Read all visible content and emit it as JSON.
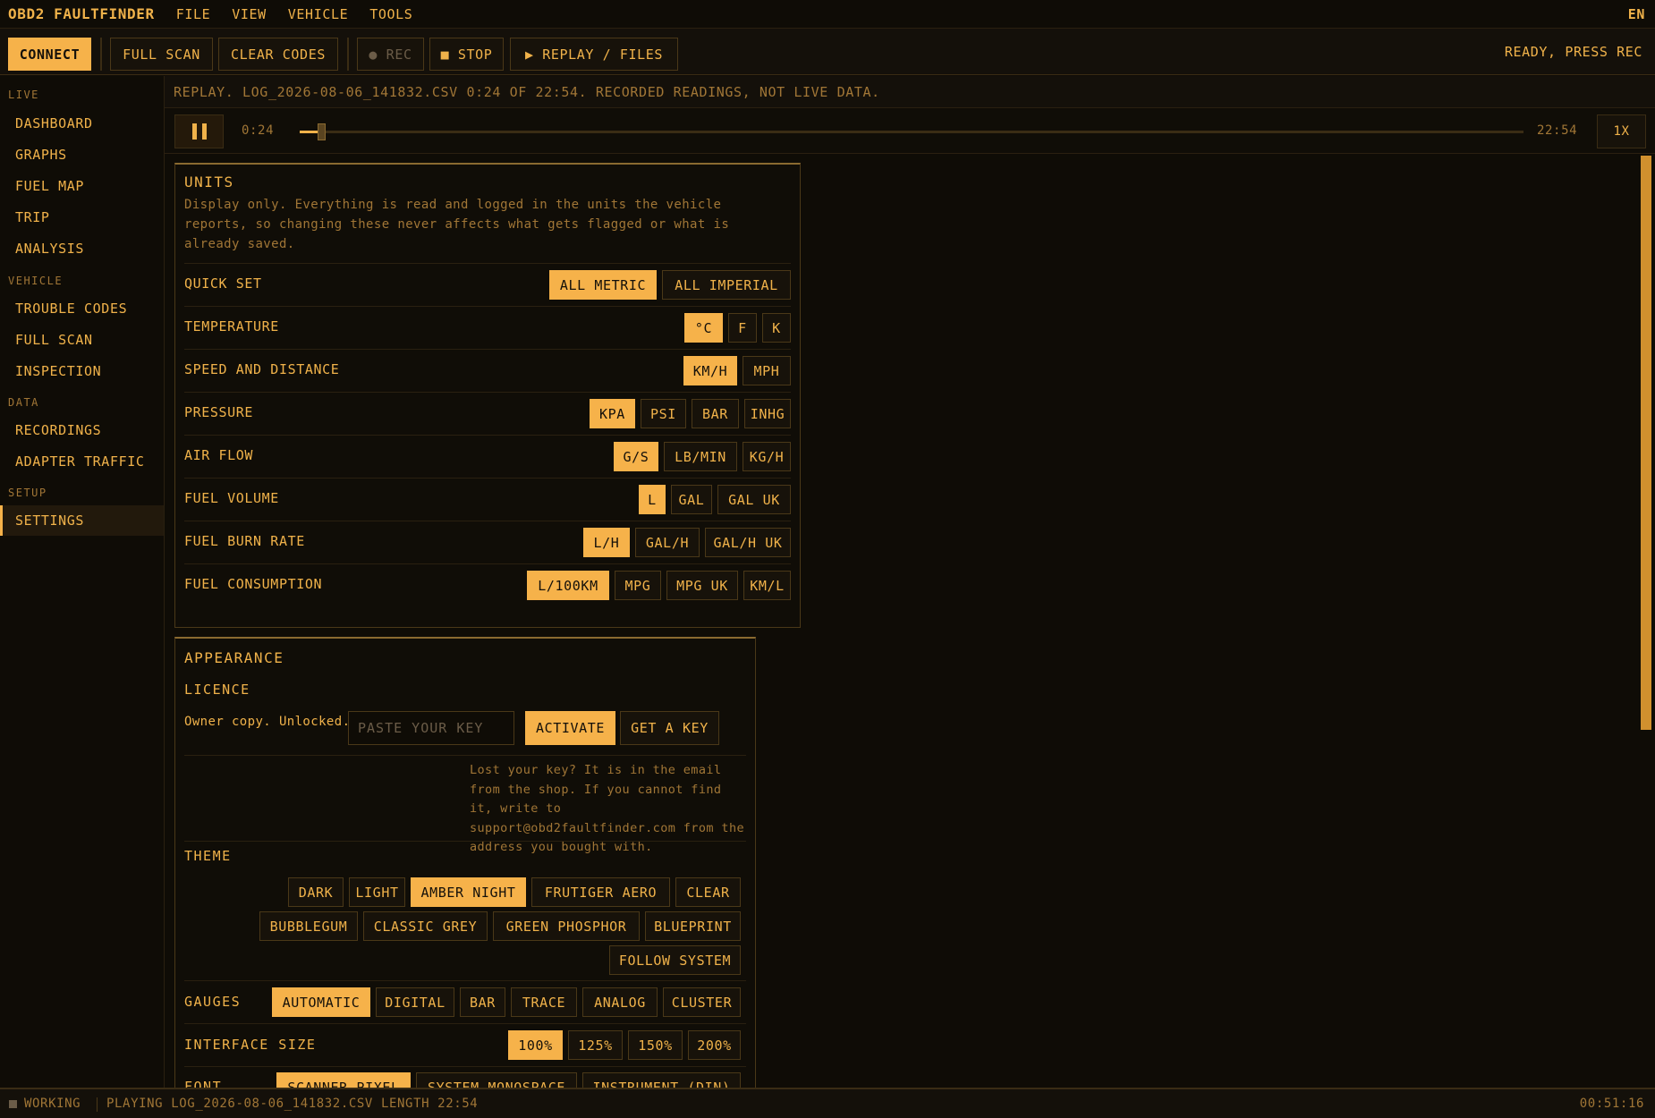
{
  "menubar": {
    "brand": "OBD2 FAULTFINDER",
    "menus": [
      "FILE",
      "VIEW",
      "VEHICLE",
      "TOOLS"
    ],
    "language": "EN"
  },
  "toolbar": {
    "connect": "CONNECT",
    "full_scan": "FULL SCAN",
    "clear_codes": "CLEAR CODES",
    "rec": "● REC",
    "stop": "■ STOP",
    "replay_files": "▶ REPLAY / FILES",
    "status": "READY, PRESS REC"
  },
  "sidebar": {
    "sections": [
      {
        "title": "LIVE",
        "items": [
          "DASHBOARD",
          "GRAPHS",
          "FUEL MAP",
          "TRIP",
          "ANALYSIS"
        ]
      },
      {
        "title": "VEHICLE",
        "items": [
          "TROUBLE CODES",
          "FULL SCAN",
          "INSPECTION"
        ]
      },
      {
        "title": "DATA",
        "items": [
          "RECORDINGS",
          "ADAPTER TRAFFIC"
        ]
      },
      {
        "title": "SETUP",
        "items": [
          "SETTINGS"
        ]
      }
    ],
    "active": "SETTINGS"
  },
  "replay": {
    "banner": "REPLAY. LOG_2026-08-06_141832.CSV 0:24 OF 22:54. RECORDED READINGS, NOT LIVE DATA.",
    "current": "0:24",
    "length": "22:54",
    "progress": 0.0175,
    "speed": "1X"
  },
  "units": {
    "title": "UNITS",
    "description": "Display only. Everything is read and logged in the units the vehicle reports, so changing these never affects what gets flagged or what is already saved.",
    "rows": [
      {
        "label": "QUICK SET",
        "options": [
          "ALL METRIC",
          "ALL IMPERIAL"
        ],
        "selected": 0
      },
      {
        "label": "TEMPERATURE",
        "options": [
          "°C",
          "F",
          "K"
        ],
        "selected": 0
      },
      {
        "label": "SPEED AND DISTANCE",
        "options": [
          "KM/H",
          "MPH"
        ],
        "selected": 0
      },
      {
        "label": "PRESSURE",
        "options": [
          "KPA",
          "PSI",
          "BAR",
          "INHG"
        ],
        "selected": 0
      },
      {
        "label": "AIR FLOW",
        "options": [
          "G/S",
          "LB/MIN",
          "KG/H"
        ],
        "selected": 0
      },
      {
        "label": "FUEL VOLUME",
        "options": [
          "L",
          "GAL",
          "GAL UK"
        ],
        "selected": 0
      },
      {
        "label": "FUEL BURN RATE",
        "options": [
          "L/H",
          "GAL/H",
          "GAL/H UK"
        ],
        "selected": 0
      },
      {
        "label": "FUEL CONSUMPTION",
        "options": [
          "L/100KM",
          "MPG",
          "MPG UK",
          "KM/L"
        ],
        "selected": 0
      }
    ]
  },
  "appearance": {
    "title": "APPEARANCE",
    "licence": {
      "title": "LICENCE",
      "status": "Owner copy. Unlocked.",
      "placeholder": "PASTE YOUR KEY",
      "activate": "ACTIVATE",
      "get_key": "GET A KEY",
      "help": "Lost your key? It is in the email from the shop. If you cannot find it, write to support@obd2faultfinder.com from the address you bought with."
    },
    "theme": {
      "label": "THEME",
      "rows": [
        [
          "DARK",
          "LIGHT",
          "AMBER NIGHT",
          "FRUTIGER AERO",
          "CLEAR"
        ],
        [
          "BUBBLEGUM",
          "CLASSIC GREY",
          "GREEN PHOSPHOR",
          "BLUEPRINT"
        ],
        [
          "FOLLOW SYSTEM"
        ]
      ],
      "selected": "AMBER NIGHT"
    },
    "gauges": {
      "label": "GAUGES",
      "options": [
        "AUTOMATIC",
        "DIGITAL",
        "BAR",
        "TRACE",
        "ANALOG",
        "CLUSTER"
      ],
      "selected": 0
    },
    "interface_size": {
      "label": "INTERFACE SIZE",
      "options": [
        "100%",
        "125%",
        "150%",
        "200%"
      ],
      "selected": 0
    },
    "font": {
      "label": "FONT",
      "options": [
        "SCANNER PIXEL",
        "SYSTEM MONOSPACE",
        "INSTRUMENT (DIN)"
      ],
      "selected": 0
    }
  },
  "statusbar": {
    "working": "WORKING",
    "playing": "PLAYING LOG_2026-08-06_141832.CSV LENGTH 22:54",
    "clock": "00:51:16"
  },
  "colors": {
    "accent": "#f6b24a",
    "background": "#0f0c06",
    "muted": "#a17636"
  }
}
